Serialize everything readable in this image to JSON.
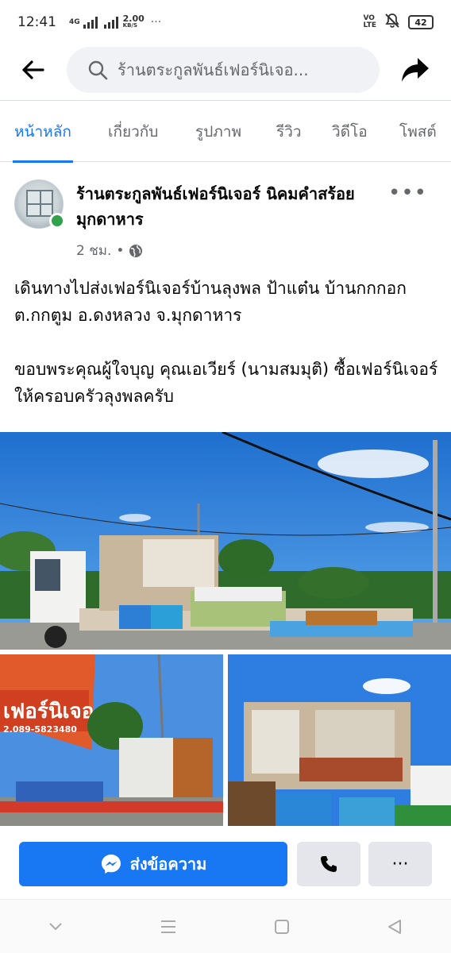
{
  "status_bar": {
    "time": "12:41",
    "network": "4G",
    "speed_value": "2.00",
    "speed_unit": "KB/S",
    "dots": "···",
    "volte": "VO\nLTE",
    "battery": "42"
  },
  "top_bar": {
    "search_text": "ร้านตระกูลพันธ์เฟอร์นิเจอ...",
    "back_icon": "arrow-left-icon",
    "share_icon": "share-arrow-icon"
  },
  "tabs": [
    {
      "label": "หน้าหลัก",
      "active": true
    },
    {
      "label": "เกี่ยวกับ",
      "active": false
    },
    {
      "label": "รูปภาพ",
      "active": false
    },
    {
      "label": "รีวิว",
      "active": false
    },
    {
      "label": "วิดีโอ",
      "active": false
    },
    {
      "label": "โพสต์",
      "active": false
    }
  ],
  "post": {
    "page_name": "ร้านตระกูลพันธ์เฟอร์นิเจอร์ นิคมคำสร้อย มุกดาหาร",
    "time_ago": "2 ชม.",
    "dot": "•",
    "paragraph_1": "เดินทางไปส่งเฟอร์นิเจอร์บ้านลุงพล ป้าแต๋น บ้านกกกอก ต.กกตูม อ.ดงหลวง จ.มุกดาหาร",
    "paragraph_2": "ขอบพระคุณผู้ใจบุญ คุณเอเวียร์ (นามสมมุติ) ซื้อเฟอร์นิเจอร์ให้ครอบครัวลุงพลครับ",
    "more_label": "•••"
  },
  "photos": {
    "sign_text": "เฟอร์นิเจอ",
    "sign_phone": "2.089-5823480"
  },
  "actions": {
    "message_label": "ส่งข้อความ",
    "more_label": "···"
  },
  "colors": {
    "accent": "#1877f2",
    "online": "#31a24c",
    "secondary_text": "#65676b"
  }
}
